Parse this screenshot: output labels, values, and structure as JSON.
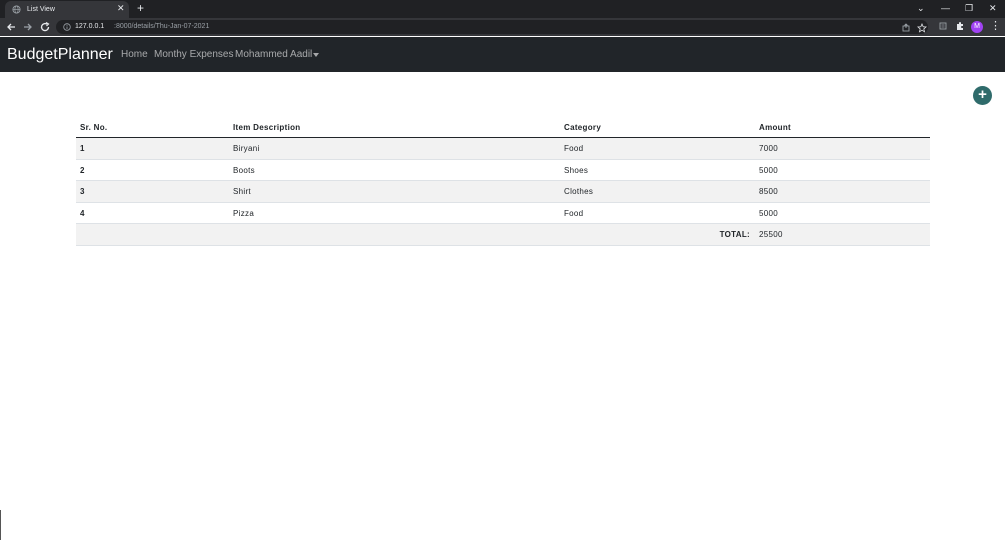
{
  "browser": {
    "tab_title": "List View",
    "tab_close": "✕",
    "new_tab": "+",
    "url_host": "127.0.0.1",
    "url_path": ":8000/details/Thu-Jan-07-2021",
    "avatar_letter": "M",
    "window_controls": [
      "⌄",
      "—",
      "❐",
      "✕"
    ]
  },
  "navbar": {
    "brand": "BudgetPlanner",
    "links": [
      "Home",
      "Monthy Expenses",
      "Mohammed Aadil"
    ]
  },
  "add_button": {
    "label": "+",
    "color": "#2f6b6b"
  },
  "table": {
    "headers": [
      "Sr. No.",
      "Item Description",
      "Category",
      "Amount"
    ],
    "rows": [
      {
        "sr": "1",
        "item": "Biryani",
        "category": "Food",
        "amount": "7000"
      },
      {
        "sr": "2",
        "item": "Boots",
        "category": "Shoes",
        "amount": "5000"
      },
      {
        "sr": "3",
        "item": "Shirt",
        "category": "Clothes",
        "amount": "8500"
      },
      {
        "sr": "4",
        "item": "Pizza",
        "category": "Food",
        "amount": "5000"
      }
    ],
    "total_label": "TOTAL:",
    "total_value": "25500"
  }
}
